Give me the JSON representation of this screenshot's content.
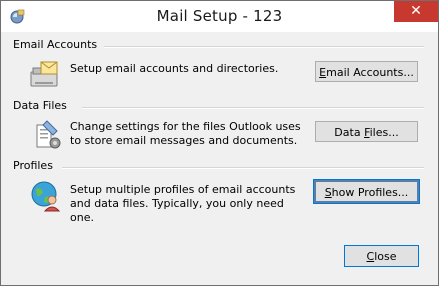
{
  "window": {
    "title": "Mail Setup - 123",
    "close_glyph": "✕"
  },
  "sections": {
    "email": {
      "heading": "Email Accounts",
      "description": "Setup email accounts and directories.",
      "button_pre": "",
      "button_hot": "E",
      "button_post": "mail Accounts...",
      "icon": "email-accounts-icon"
    },
    "datafiles": {
      "heading": "Data Files",
      "description": "Change settings for the files Outlook uses to store email messages and documents.",
      "button_pre": "Data ",
      "button_hot": "F",
      "button_post": "iles...",
      "icon": "data-files-icon"
    },
    "profiles": {
      "heading": "Profiles",
      "description": "Setup multiple profiles of email accounts and data files. Typically, you only need one.",
      "button_pre": "",
      "button_hot": "S",
      "button_post": "how Profiles...",
      "icon": "profiles-icon"
    }
  },
  "footer": {
    "close_pre": "",
    "close_hot": "C",
    "close_post": "lose"
  },
  "colors": {
    "close_button": "#c7392e",
    "focus_ring": "#5a7ea6",
    "dialog_bg": "#f0f0f0"
  }
}
